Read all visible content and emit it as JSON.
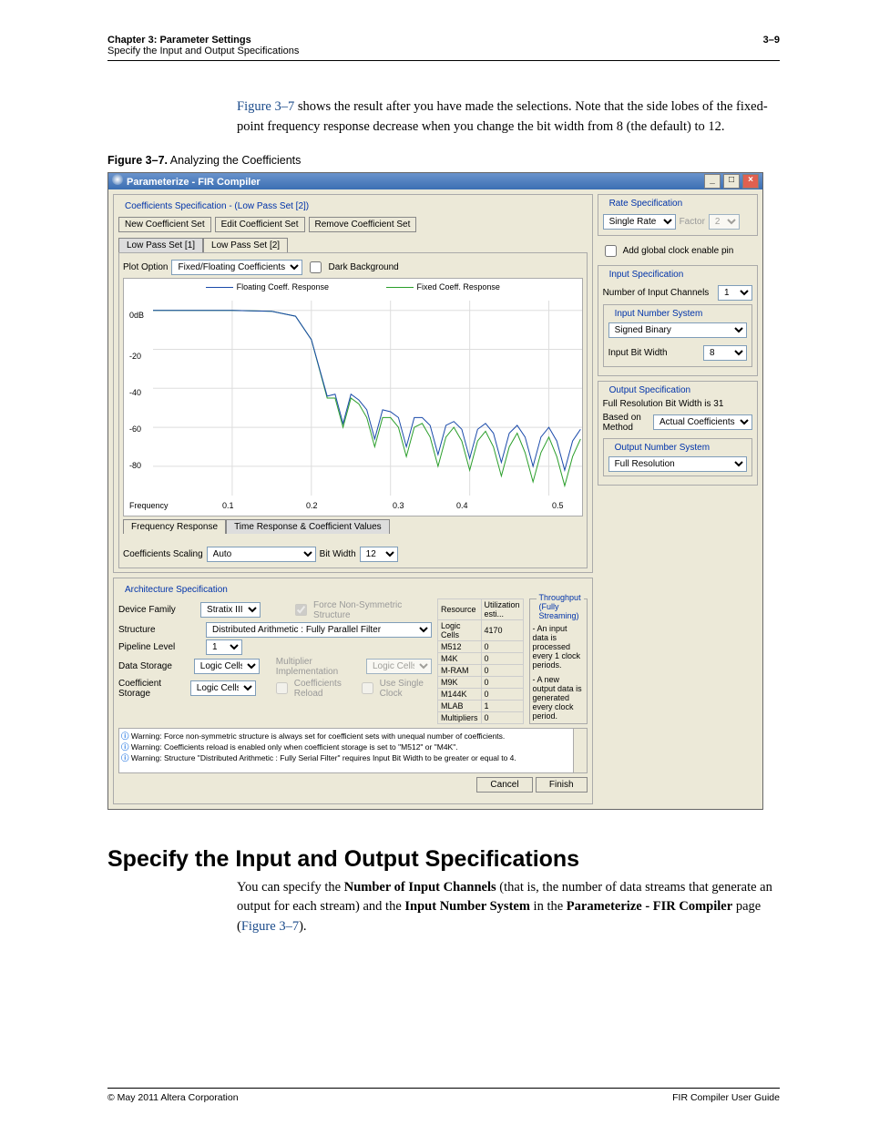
{
  "header": {
    "chapter": "Chapter 3:  Parameter Settings",
    "section": "Specify the Input and Output Specifications",
    "pageno": "3–9"
  },
  "intro": {
    "ref": "Figure 3–7",
    "text_after": " shows the result after you have made the selections. Note that the side lobes of the fixed-point frequency response decrease when you change the bit width from 8 (the default) to 12."
  },
  "fig": {
    "num": "Figure 3–7.",
    "title": "Analyzing the Coefficients"
  },
  "dlg": {
    "title": "Parameterize - FIR Compiler",
    "coeff_spec_legend": "Coefficients Specification - (Low Pass Set [2])",
    "btn_new": "New Coefficient Set",
    "btn_edit": "Edit Coefficient Set",
    "btn_remove": "Remove Coefficient Set",
    "tabs": [
      "Low Pass Set [1]",
      "Low Pass Set [2]"
    ],
    "plot_option_label": "Plot Option",
    "plot_option_value": "Fixed/Floating Coefficients",
    "dark_bg": "Dark Background",
    "legend_float": "Floating Coeff. Response",
    "legend_fixed": "Fixed Coeff. Response",
    "y_ticks": {
      "top": "0dB",
      "m20": "-20",
      "m40": "-40",
      "m60": "-60",
      "m80": "-80"
    },
    "x_label": "Frequency",
    "x_ticks": {
      "x1": "0.1",
      "x2": "0.2",
      "x3": "0.3",
      "x4": "0.4",
      "x5": "0.5"
    },
    "freq_tab": "Frequency Response",
    "time_tab": "Time Response & Coefficient Values",
    "coeff_scaling_lbl": "Coefficients Scaling",
    "coeff_scaling_val": "Auto",
    "bitwidth_lbl": "Bit Width",
    "bitwidth_val": "12",
    "arch_legend": "Architecture Specification",
    "device_family_lbl": "Device Family",
    "device_family": "Stratix III",
    "force_ns": "Force Non-Symmetric Structure",
    "structure_lbl": "Structure",
    "structure": "Distributed Arithmetic : Fully Parallel Filter",
    "pipeline_lbl": "Pipeline Level",
    "pipeline": "1",
    "data_storage_lbl": "Data Storage",
    "data_storage": "Logic Cells",
    "mult_impl_lbl": "Multiplier Implementation",
    "mult_impl": "Logic Cells",
    "coef_storage_lbl": "Coefficient Storage",
    "coef_storage": "Logic Cells",
    "coef_reload": "Coefficients Reload",
    "use_single_clock": "Use Single Clock",
    "res_hdr": "Resource",
    "util_hdr": "Utilization esti...",
    "res": {
      "LogicCells": "4170",
      "M512": "0",
      "M4K": "0",
      "MRAM": "0",
      "M9K": "0",
      "M144K": "0",
      "MLAB": "1",
      "Multipliers": "0"
    },
    "thru_legend": "Throughput (Fully Streaming)",
    "thru_1": "- An input data is processed every 1 clock periods.",
    "thru_2": "- A new output data is generated every clock period.",
    "warn1": "Warning: Force non-symmetric structure is always set for coefficient sets with unequal number of coefficients.",
    "warn2": "Warning: Coefficients reload is enabled only when coefficient storage is set to \"M512\" or \"M4K\".",
    "warn3": "Warning: Structure \"Distributed Arithmetic : Fully Serial Filter\" requires Input Bit Width to be greater or equal to 4.",
    "cancel": "Cancel",
    "finish": "Finish",
    "rate_legend": "Rate Specification",
    "rate_val": "Single Rate",
    "factor_lbl": "Factor",
    "factor_val": "2",
    "add_clk": "Add global clock enable pin",
    "in_spec": "Input Specification",
    "num_ch_lbl": "Number of Input Channels",
    "num_ch": "1",
    "in_num_sys": "Input Number System",
    "in_num_sys_val": "Signed Binary",
    "in_bw_lbl": "Input Bit Width",
    "in_bw": "8",
    "out_spec": "Output Specification",
    "full_res": "Full Resolution Bit Width is 31",
    "method_lbl": "Based on Method",
    "method_val": "Actual Coefficients",
    "out_num_sys": "Output Number System",
    "out_num_sys_val": "Full Resolution"
  },
  "h1": "Specify the Input and Output Specifications",
  "p1": "You can specify the ",
  "p1b": "Number of Input Channels",
  "p1c": " (that is, the number of data streams that generate an output for each stream) and the ",
  "p1d": "Input Number System",
  "p1e": " in the ",
  "p1f": "Parameterize - FIR Compiler",
  "p1g": " page (",
  "p1h": "Figure 3–7",
  "p1i": ").",
  "footer": {
    "left": "© May 2011   Altera Corporation",
    "right": "FIR Compiler User Guide"
  },
  "chart_data": {
    "type": "line",
    "xlabel": "Frequency",
    "ylabel": "dB",
    "xlim": [
      0,
      0.55
    ],
    "ylim": [
      -95,
      5
    ],
    "xticks": [
      0.1,
      0.2,
      0.3,
      0.4,
      0.5
    ],
    "yticks": [
      0,
      -20,
      -40,
      -60,
      -80
    ],
    "series": [
      {
        "name": "Floating Coeff. Response",
        "color": "#2a9e2a",
        "x": [
          0,
          0.05,
          0.1,
          0.15,
          0.18,
          0.2,
          0.22,
          0.24,
          0.26,
          0.28,
          0.3,
          0.32,
          0.34,
          0.36,
          0.38,
          0.4,
          0.42,
          0.44,
          0.46,
          0.48,
          0.5,
          0.52,
          0.54
        ],
        "y": [
          0,
          0,
          0,
          -0.5,
          -3,
          -15,
          -45,
          -60,
          -48,
          -70,
          -55,
          -75,
          -58,
          -80,
          -60,
          -82,
          -62,
          -85,
          -63,
          -88,
          -65,
          -90,
          -66
        ]
      },
      {
        "name": "Fixed Coeff. Response",
        "color": "#1a4aaa",
        "x": [
          0,
          0.05,
          0.1,
          0.15,
          0.18,
          0.2,
          0.22,
          0.24,
          0.26,
          0.28,
          0.3,
          0.32,
          0.34,
          0.36,
          0.38,
          0.4,
          0.42,
          0.44,
          0.46,
          0.48,
          0.5,
          0.52,
          0.54
        ],
        "y": [
          0,
          0,
          0,
          -0.5,
          -3,
          -15,
          -44,
          -58,
          -46,
          -66,
          -52,
          -70,
          -55,
          -74,
          -57,
          -76,
          -58,
          -78,
          -59,
          -80,
          -60,
          -82,
          -61
        ]
      }
    ]
  }
}
